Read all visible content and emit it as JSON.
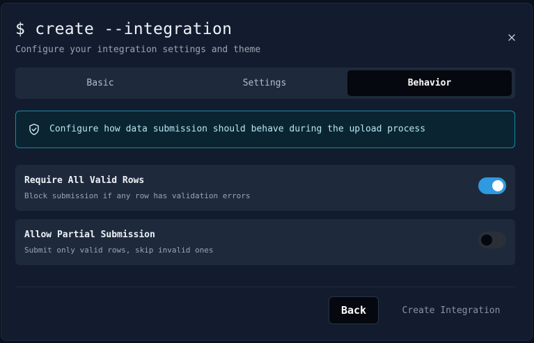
{
  "dialog": {
    "title": "$ create --integration",
    "subtitle": "Configure your integration settings and theme",
    "close_label": "×"
  },
  "tabs": [
    {
      "label": "Basic",
      "active": false
    },
    {
      "label": "Settings",
      "active": false
    },
    {
      "label": "Behavior",
      "active": true
    }
  ],
  "info": {
    "icon": "shield-check-icon",
    "text": "Configure how data submission should behave during the upload process"
  },
  "options": [
    {
      "label": "Require All Valid Rows",
      "description": "Block submission if any row has validation errors",
      "enabled": true
    },
    {
      "label": "Allow Partial Submission",
      "description": "Submit only valid rows, skip invalid ones",
      "enabled": false
    }
  ],
  "footer": {
    "back_label": "Back",
    "create_label": "Create Integration"
  },
  "colors": {
    "accent": "#2f9adf",
    "info_border": "#1a8aa3",
    "dialog_bg": "#121c2e"
  }
}
